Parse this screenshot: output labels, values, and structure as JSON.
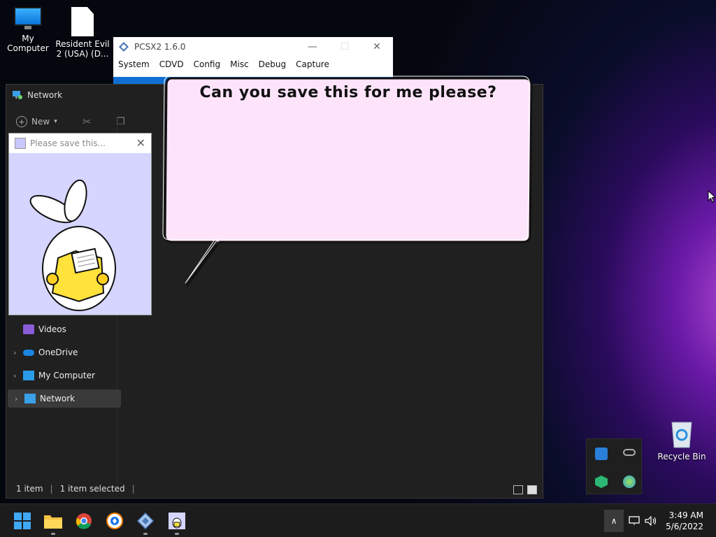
{
  "desktop": {
    "icons": [
      {
        "label": "My Computer"
      },
      {
        "label": "Resident Evil 2 (USA) (D..."
      }
    ],
    "recycle_bin_label": "Recycle Bin"
  },
  "pcsx2": {
    "title": "PCSX2  1.6.0",
    "menu": [
      "System",
      "CDVD",
      "Config",
      "Misc",
      "Debug",
      "Capture"
    ]
  },
  "explorer": {
    "title": "Network",
    "new_label": "New",
    "nav": [
      {
        "label": "Videos",
        "icon": "video-icon",
        "chevron": ""
      },
      {
        "label": "OneDrive",
        "icon": "cloud-icon",
        "chevron": ">"
      },
      {
        "label": "My Computer",
        "icon": "monitor-icon",
        "chevron": ">"
      },
      {
        "label": "Network",
        "icon": "network-icon",
        "chevron": ">"
      }
    ],
    "status_items": "1 item",
    "status_selected": "1 item selected"
  },
  "popup": {
    "title": "Please save this..."
  },
  "bubble": {
    "text": "Can you save this for me please?"
  },
  "taskbar": {
    "time": "3:49 AM",
    "date": "5/6/2022",
    "apps": [
      "start-icon",
      "file-explorer-icon",
      "chrome-icon",
      "brave-icon",
      "pcsx2-icon",
      "bunny-app-icon"
    ]
  },
  "colors": {
    "accent": "#0f6fd2",
    "bubble_fill": "#fde4fa",
    "popup_bg": "#d5d5ff"
  }
}
